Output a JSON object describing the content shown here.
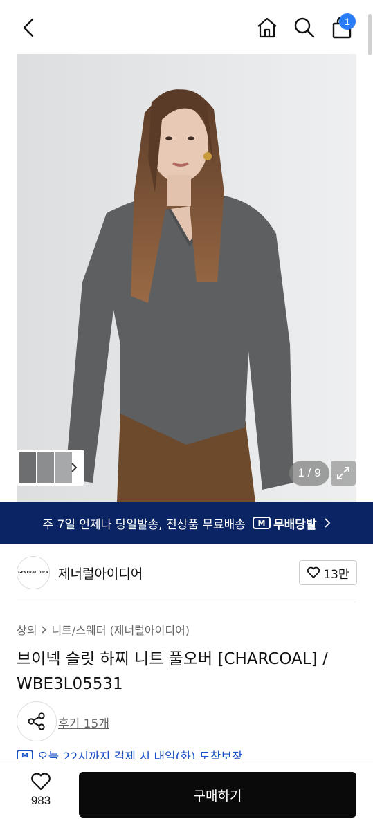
{
  "header": {
    "back_icon": "chevron-left-icon",
    "home_icon": "home-icon",
    "search_icon": "search-icon",
    "cart_icon": "shopping-bag-icon",
    "cart_count": "1"
  },
  "gallery": {
    "counter": "1 / 9",
    "expand_icon": "expand-icon"
  },
  "banner": {
    "text": "주 7일 언제나 당일발송, 전상품 무료배송",
    "badge": "M",
    "brand": "무배당발"
  },
  "brand": {
    "logo_text": "GENERAL IDEA",
    "name": "제너럴아이디어",
    "like_count": "13만"
  },
  "product": {
    "breadcrumb": [
      "상의",
      "니트/스웨터 (제너럴아이디어)"
    ],
    "title": "브이넥 슬릿 하찌 니트 풀오버 [CHARCOAL] / WBE3L05531",
    "reviews": "후기 15개",
    "delivery_note": "오늘 22시까지 결제 시 내일(화) 도착보장"
  },
  "bottom": {
    "wish_count": "983",
    "buy_label": "구매하기"
  },
  "colors": {
    "banner": "#0b2463",
    "badge": "#2a7cf6",
    "delivery": "#1a52c7",
    "buy": "#0a0a0a"
  }
}
